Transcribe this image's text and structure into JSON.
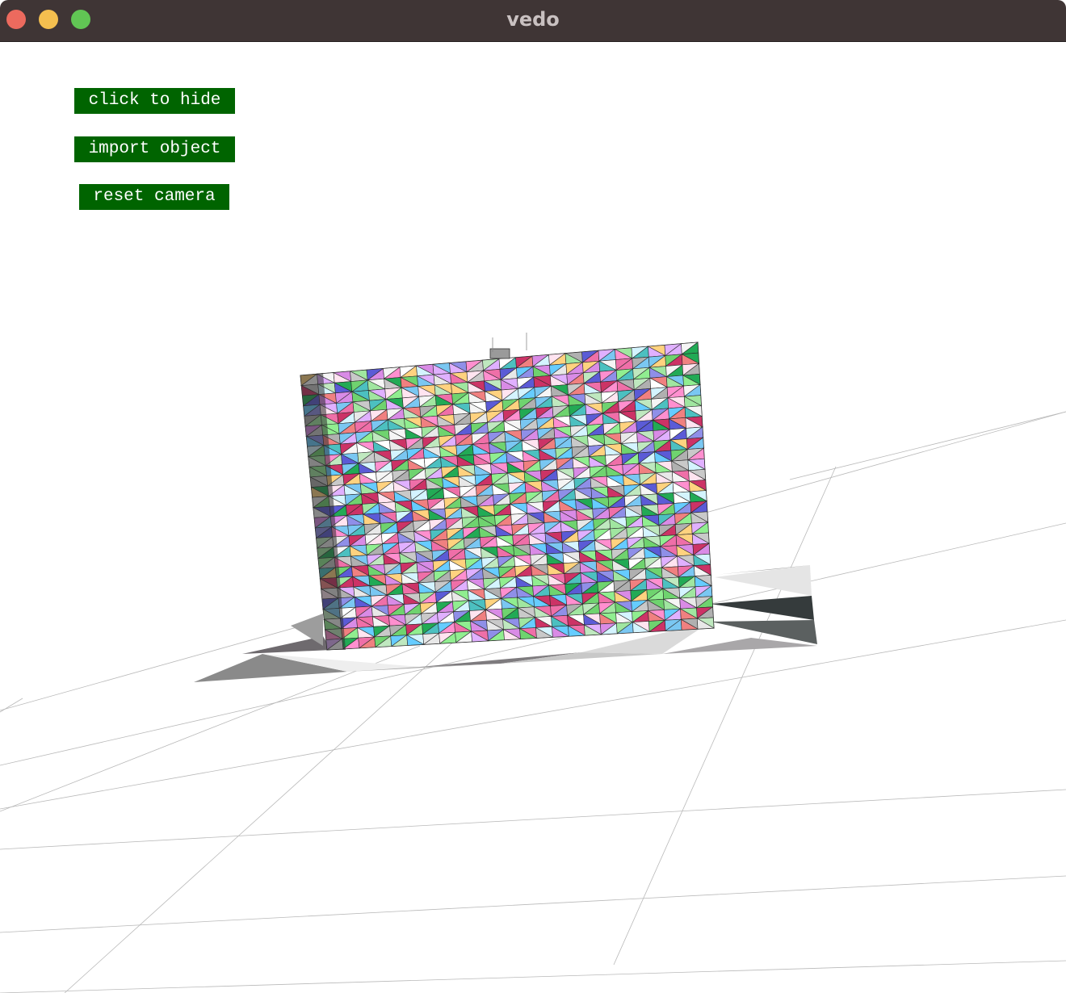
{
  "window": {
    "title": "vedo"
  },
  "buttons": {
    "hide_label": "click to hide",
    "import_label": "import object",
    "reset_label": "reset camera"
  },
  "colors": {
    "button_bg": "#006400",
    "button_text": "#ffffff",
    "titlebar": "#3f3535",
    "background": "#ffffff"
  }
}
